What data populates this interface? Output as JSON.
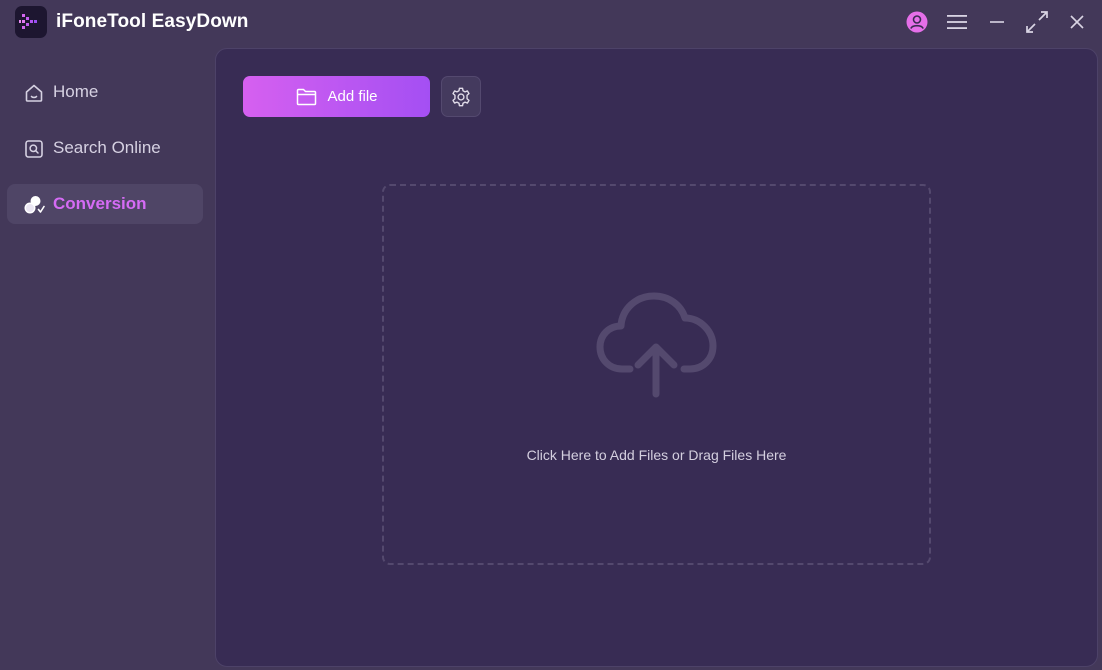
{
  "app": {
    "title": "iFoneTool EasyDown"
  },
  "titlebar": {
    "icons": [
      "user-icon",
      "menu-icon",
      "minimize-icon",
      "maximize-icon",
      "close-icon"
    ]
  },
  "sidebar": {
    "items": [
      {
        "label": "Home",
        "icon": "home-icon",
        "active": false
      },
      {
        "label": "Search Online",
        "icon": "search-icon",
        "active": false
      },
      {
        "label": "Conversion",
        "icon": "conversion-icon",
        "active": true
      }
    ]
  },
  "toolbar": {
    "add_file_label": "Add file",
    "add_file_icon": "folder-icon",
    "settings_icon": "gear-icon"
  },
  "drop_zone": {
    "icon": "cloud-upload-icon",
    "text": "Click Here to Add Files or Drag Files Here"
  },
  "colors": {
    "window_bg": "#433859",
    "panel_bg": "#382c54",
    "accent": "#d56bf5",
    "button_gradient_start": "#d660f0",
    "button_gradient_end": "#a44ff3"
  }
}
